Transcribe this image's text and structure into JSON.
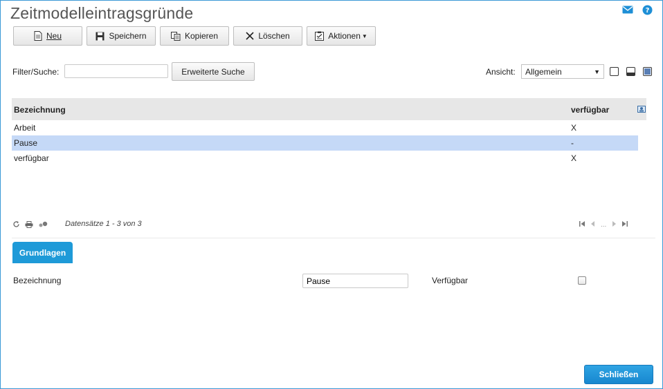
{
  "page": {
    "title": "Zeitmodelleintragsgründe"
  },
  "toolbar": {
    "new_label": "Neu",
    "save_label": "Speichern",
    "copy_label": "Kopieren",
    "delete_label": "Löschen",
    "actions_label": "Aktionen"
  },
  "filter": {
    "label": "Filter/Suche:",
    "value": "",
    "advanced_search_label": "Erweiterte Suche"
  },
  "view": {
    "label": "Ansicht:",
    "selected": "Allgemein"
  },
  "grid": {
    "columns": [
      "Bezeichnung",
      "verfügbar"
    ],
    "rows": [
      {
        "bezeichnung": "Arbeit",
        "verfuegbar": "X",
        "selected": false
      },
      {
        "bezeichnung": "Pause",
        "verfuegbar": "-",
        "selected": true
      },
      {
        "bezeichnung": "verfügbar",
        "verfuegbar": "X",
        "selected": false
      }
    ],
    "records_label": "Datensätze 1 - 3 von 3",
    "pager_ellipsis": "..."
  },
  "detail": {
    "tab_label": "Grundlagen",
    "name_label": "Bezeichnung",
    "name_value": "Pause",
    "available_label": "Verfügbar",
    "available_checked": false
  },
  "footer": {
    "close_label": "Schließen"
  },
  "colors": {
    "accent": "#1e9ad8",
    "selection": "#c5d9f7",
    "header_bg": "#e7e7e7",
    "frame_border": "#3a98d6"
  },
  "icons": [
    "mail-icon",
    "help-icon",
    "document-icon",
    "floppy-icon",
    "copy-icon",
    "x-icon",
    "clipboard-icon",
    "refresh-icon",
    "print-icon",
    "settings-icon",
    "column-chooser-icon"
  ]
}
